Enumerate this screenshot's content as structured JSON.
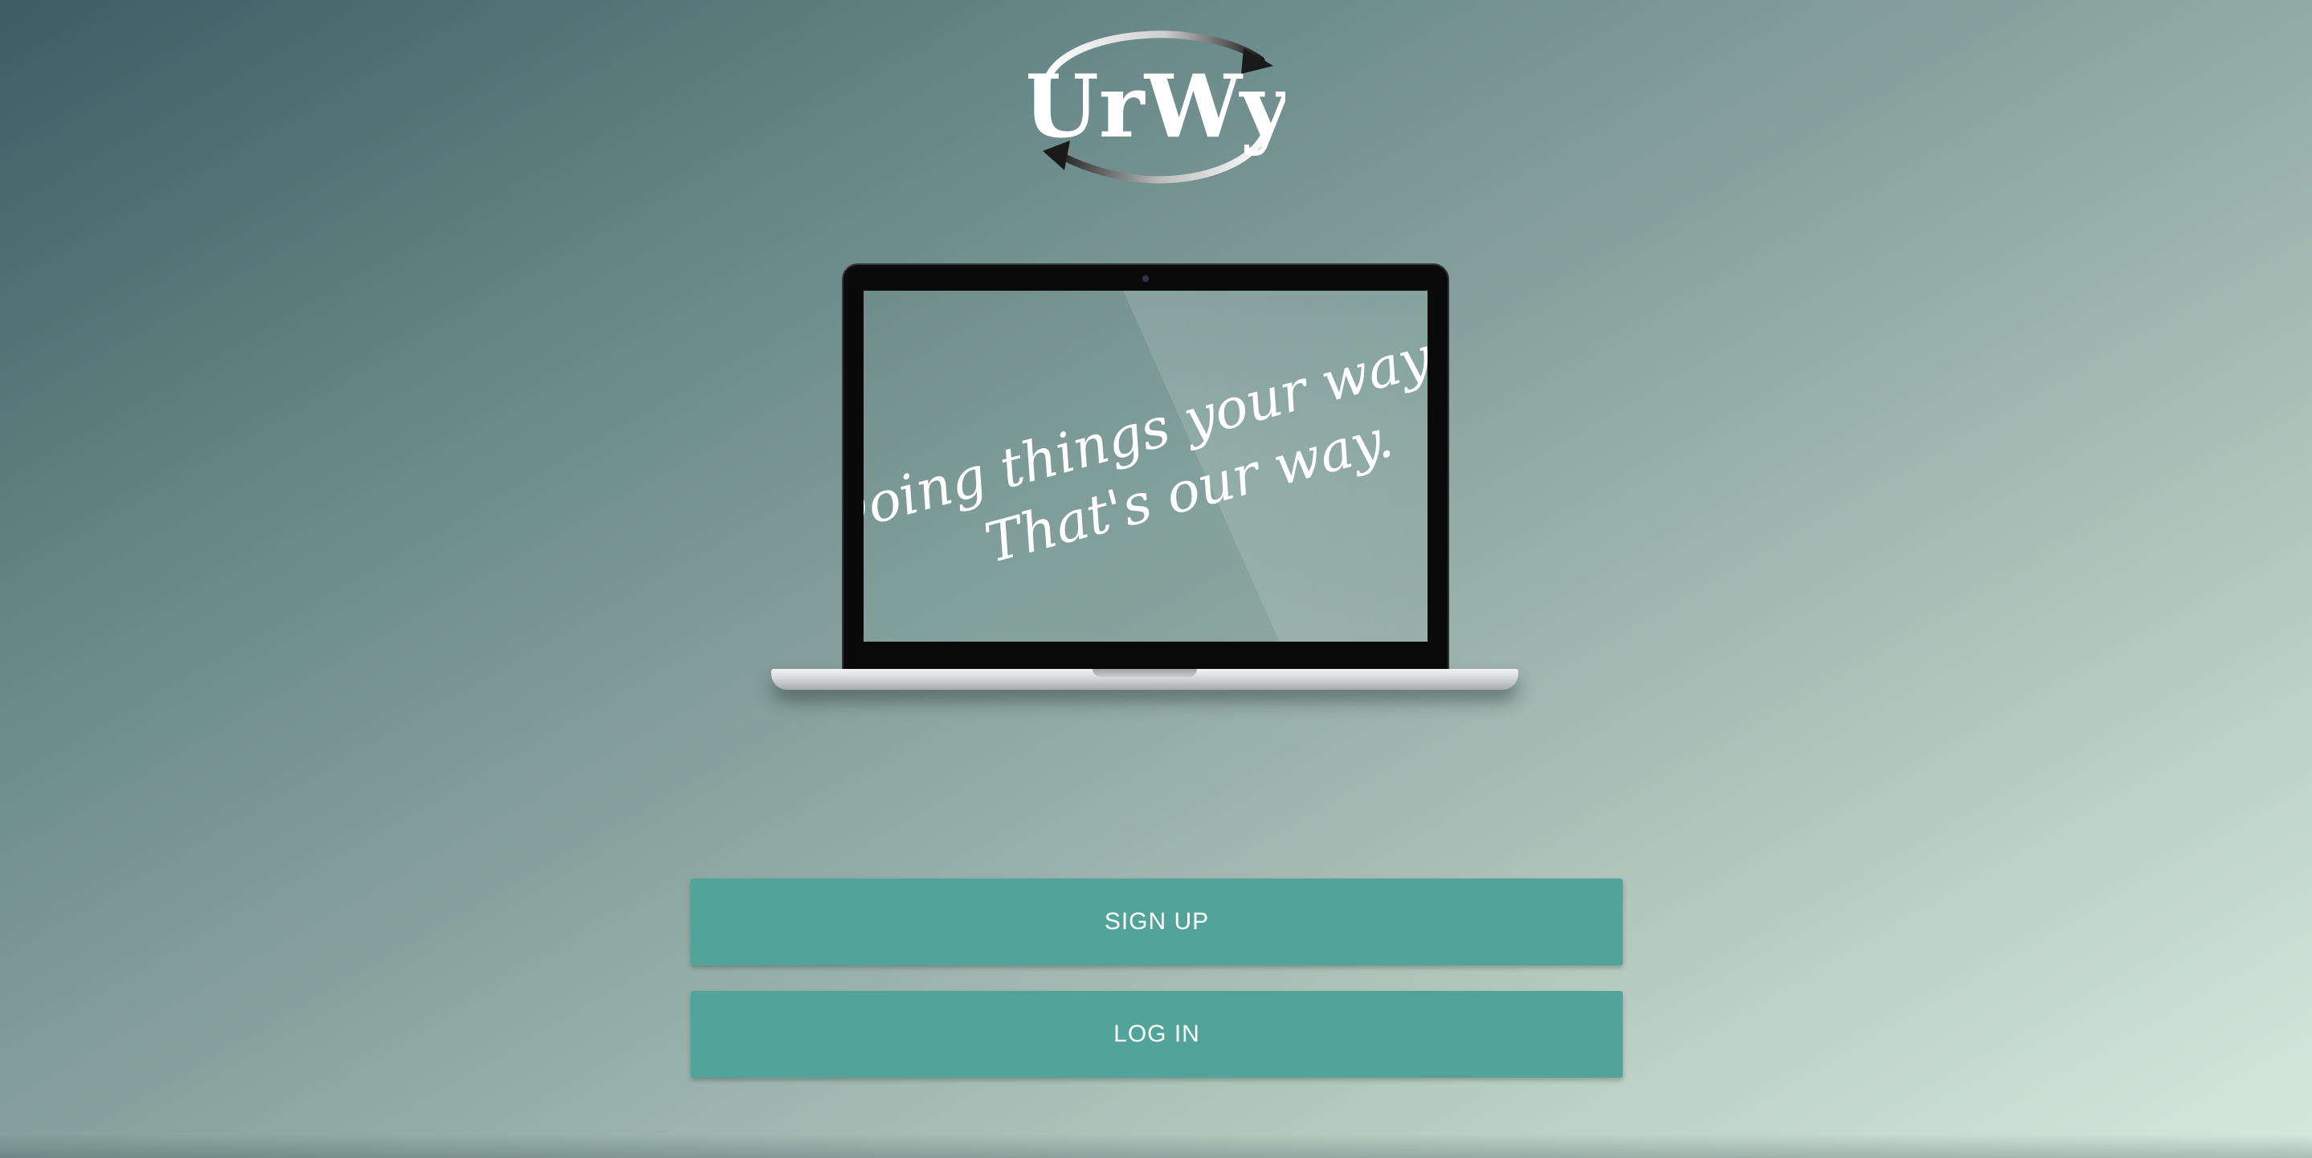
{
  "logo": {
    "text": "UrWy",
    "icon": "circular-arrows-icon"
  },
  "hero": {
    "tagline_line1": "Doing things your way.",
    "tagline_line2": "That's our way."
  },
  "actions": {
    "signup_label": "SIGN UP",
    "login_label": "LOG IN"
  },
  "colors": {
    "button": "#52a49a",
    "background_start": "#3e5d63",
    "background_end": "#d6e9dd"
  }
}
